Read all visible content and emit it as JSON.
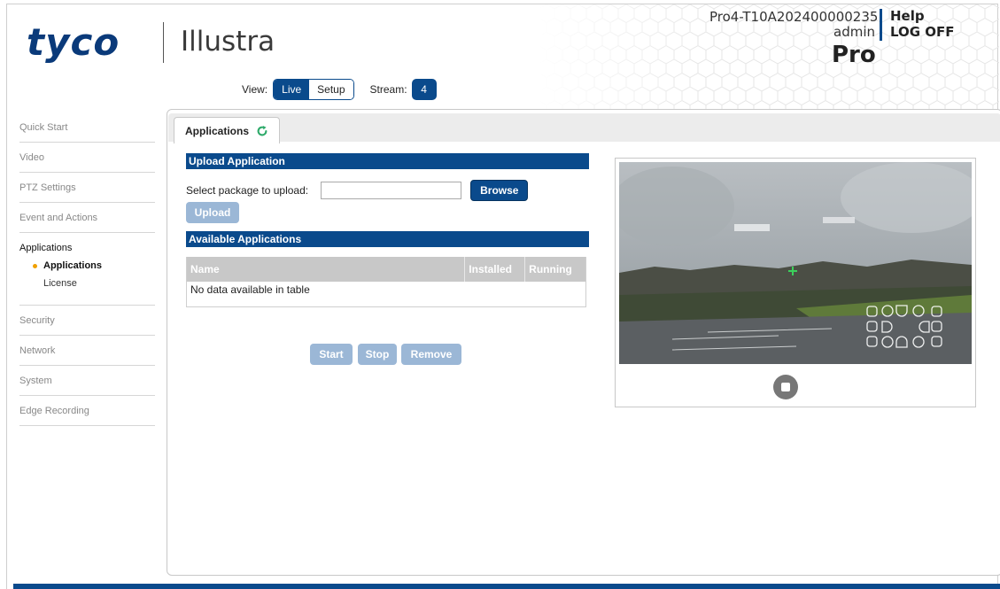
{
  "header": {
    "logo_primary": "tyco",
    "logo_secondary": "Illustra",
    "device_name": "Pro4-T10A202400000235",
    "user": "admin",
    "help_label": "Help",
    "logoff_label": "LOG OFF",
    "product": "Pro"
  },
  "view_bar": {
    "view_label": "View:",
    "live_label": "Live",
    "setup_label": "Setup",
    "stream_label": "Stream:",
    "stream_value": "4"
  },
  "sidebar": {
    "items": [
      {
        "label": "Quick Start"
      },
      {
        "label": "Video"
      },
      {
        "label": "PTZ Settings"
      },
      {
        "label": "Event and Actions"
      }
    ],
    "group": {
      "title": "Applications",
      "children": [
        {
          "label": "Applications",
          "active": true
        },
        {
          "label": "License",
          "active": false
        }
      ]
    },
    "items_after": [
      {
        "label": "Security"
      },
      {
        "label": "Network"
      },
      {
        "label": "System"
      },
      {
        "label": "Edge Recording"
      }
    ]
  },
  "tab": {
    "label": "Applications",
    "refresh_icon": "refresh-icon"
  },
  "upload": {
    "section_title": "Upload Application",
    "select_label": "Select package to upload:",
    "file_value": "",
    "browse_label": "Browse",
    "upload_label": "Upload"
  },
  "available": {
    "section_title": "Available Applications",
    "columns": [
      "Name",
      "Installed",
      "Running"
    ],
    "empty_text": "No data available in table"
  },
  "actions": {
    "start_label": "Start",
    "stop_label": "Stop",
    "remove_label": "Remove"
  },
  "colors": {
    "brand_blue": "#0a4a8c",
    "disabled_blue": "#9bb7d6",
    "active_dot": "#f0a000",
    "refresh_green": "#2eaa6a"
  }
}
